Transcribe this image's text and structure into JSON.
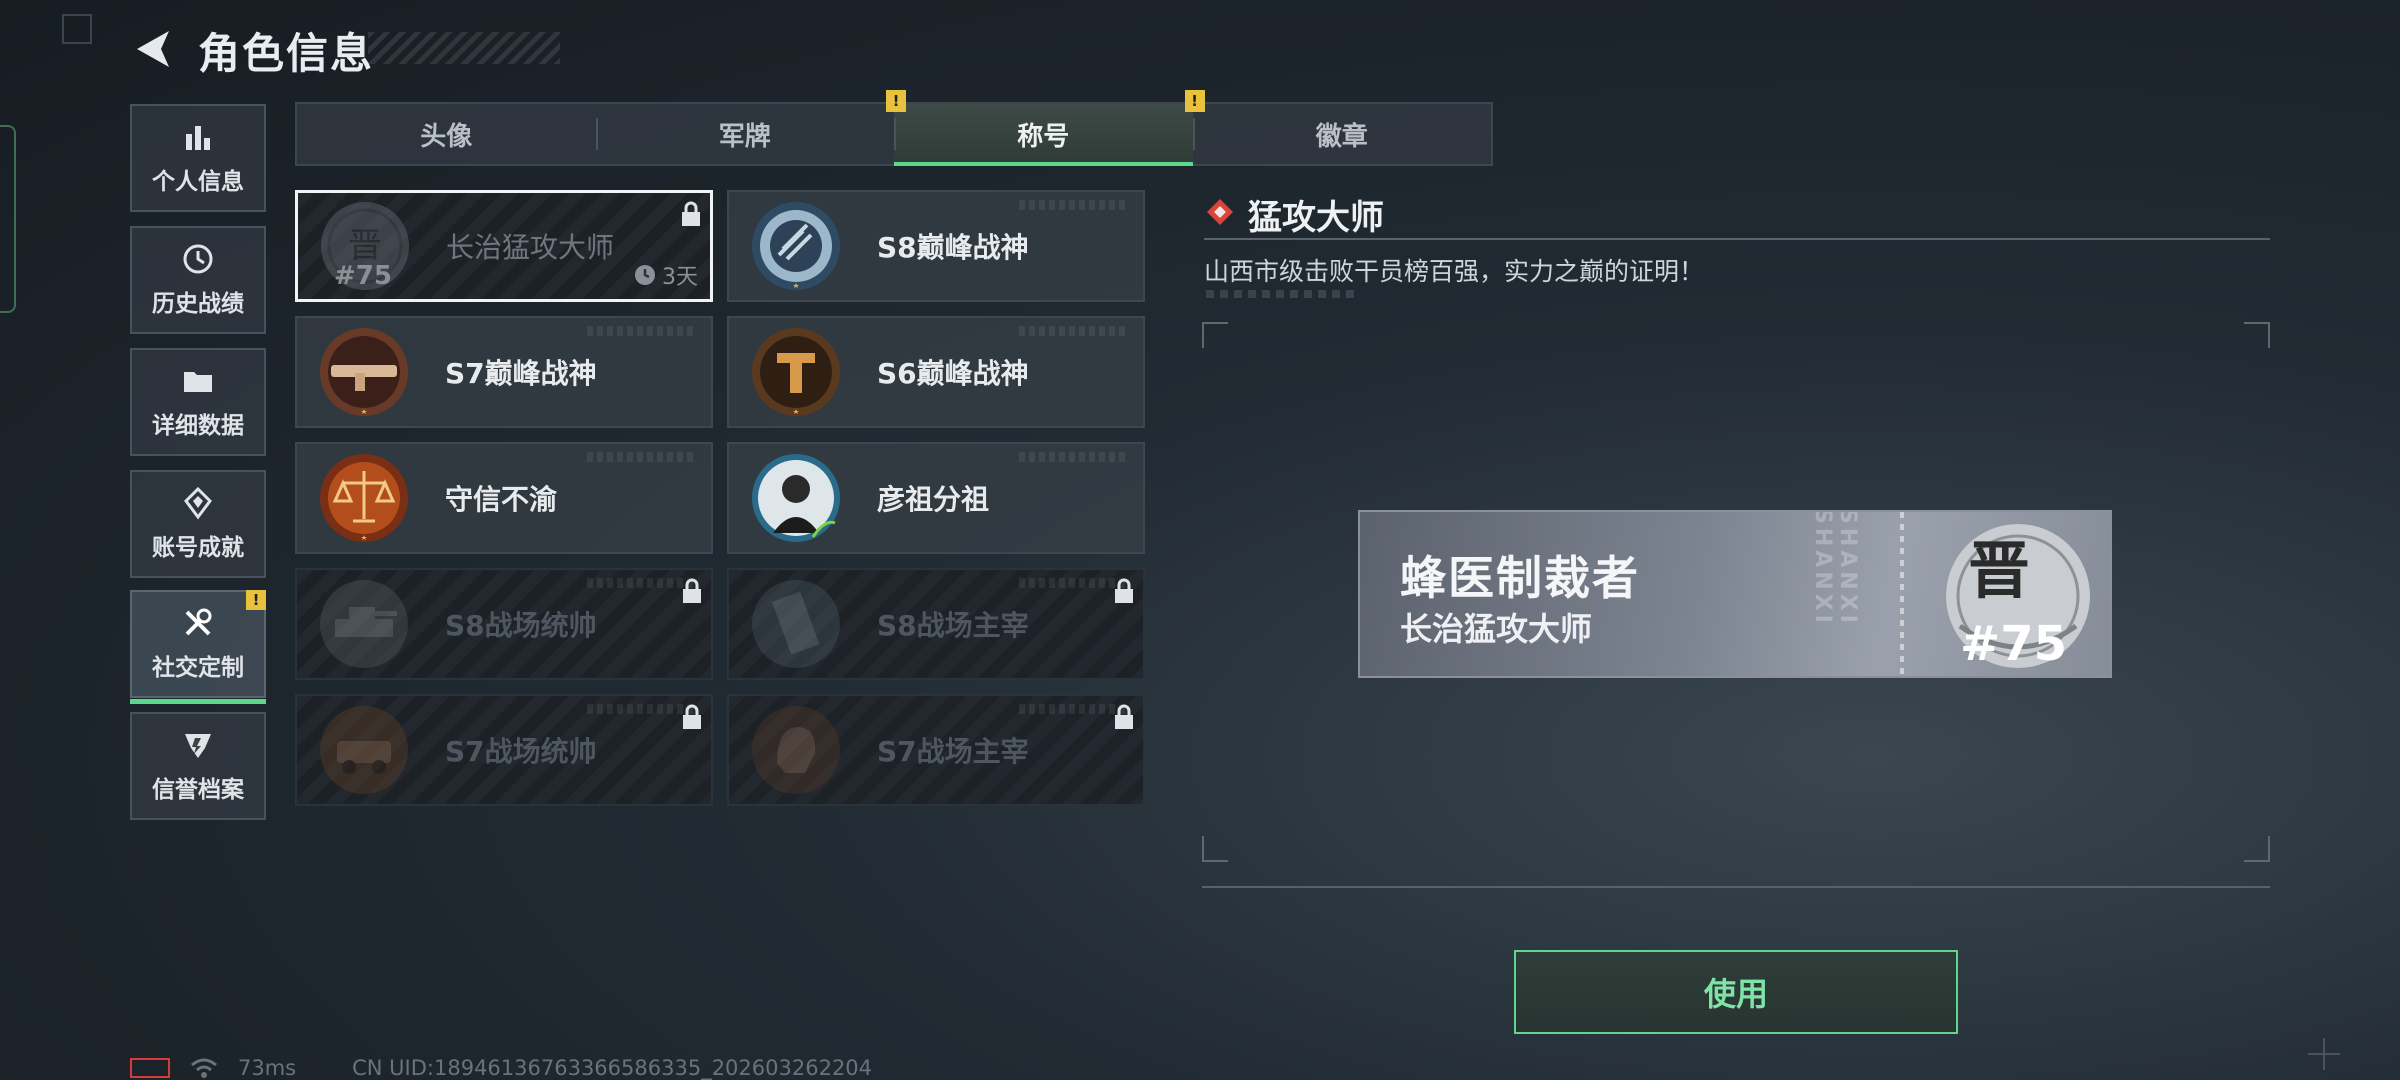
{
  "header": {
    "title": "角色信息"
  },
  "nav": [
    {
      "label": "个人信息",
      "icon": "bar-chart-icon"
    },
    {
      "label": "历史战绩",
      "icon": "history-clock-icon"
    },
    {
      "label": "详细数据",
      "icon": "folder-icon"
    },
    {
      "label": "账号成就",
      "icon": "achievement-icon"
    },
    {
      "label": "社交定制",
      "icon": "tools-icon",
      "active": true,
      "badge": "!"
    },
    {
      "label": "信誉档案",
      "icon": "shield-icon"
    }
  ],
  "tabs": [
    {
      "label": "头像"
    },
    {
      "label": "军牌",
      "badge": "!"
    },
    {
      "label": "称号",
      "active": true,
      "badge": "!"
    },
    {
      "label": "徽章"
    }
  ],
  "titles": [
    {
      "name": "长治猛攻大师",
      "emblem": "jin-seal-emblem",
      "selected": true,
      "locked": true,
      "emblem_number": "#75",
      "timer": "3天"
    },
    {
      "name": "S8巅峰战神",
      "emblem": "s8-peak-emblem"
    },
    {
      "name": "S7巅峰战神",
      "emblem": "s7-peak-emblem"
    },
    {
      "name": "S6巅峰战神",
      "emblem": "s6-peak-emblem"
    },
    {
      "name": "守信不渝",
      "emblem": "scales-emblem"
    },
    {
      "name": "彦祖分祖",
      "emblem": "portrait-emblem"
    },
    {
      "name": "S8战场统帅",
      "emblem": "tank-emblem",
      "locked": true
    },
    {
      "name": "S8战场主宰",
      "emblem": "building-emblem",
      "locked": true
    },
    {
      "name": "S7战场统帅",
      "emblem": "vehicle-emblem",
      "locked": true
    },
    {
      "name": "S7战场主宰",
      "emblem": "helmet-emblem",
      "locked": true
    }
  ],
  "detail": {
    "title": "猛攻大师",
    "description": "山西市级击败干员榜百强，实力之巅的证明！",
    "preview": {
      "player_name": "蜂医制裁者",
      "title_text": "长治猛攻大师",
      "vertical_text": "SHANXI SHANXI",
      "emblem_char": "晋",
      "emblem_number": "#75"
    },
    "use_button": "使用"
  },
  "status_bar": {
    "ping": "73ms",
    "uid": "CN UID:189461367633665863​35_202603262204"
  },
  "colors": {
    "accent": "#5ad98c",
    "badge": "#e8c13d",
    "panel": "#37404a"
  }
}
